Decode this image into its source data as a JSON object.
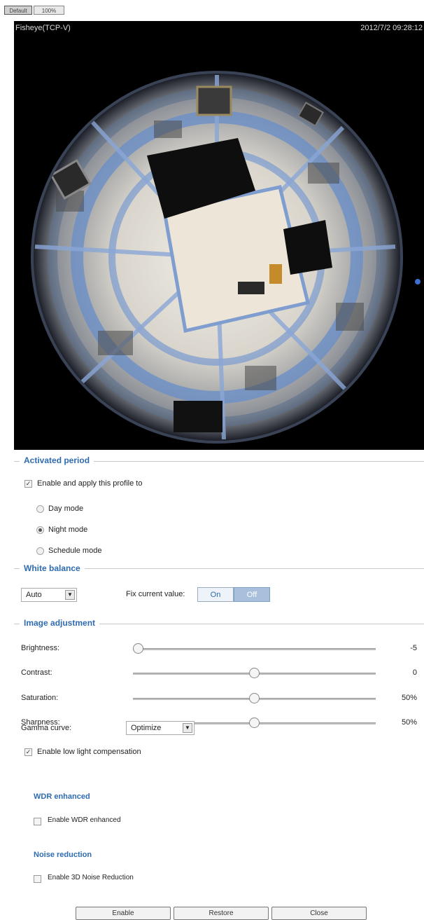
{
  "zoom_tabs": [
    "Default",
    "100%"
  ],
  "video": {
    "title": "Fisheye(TCP-V)",
    "timestamp": "2012/7/2 09:28:12"
  },
  "activated_period": {
    "title": "Activated period",
    "enable_label": "Enable and apply this profile to",
    "enable_checked": true,
    "modes": [
      {
        "label": "Day mode",
        "checked": false
      },
      {
        "label": "Night mode",
        "checked": true
      },
      {
        "label": "Schedule mode",
        "checked": false
      }
    ]
  },
  "white_balance": {
    "title": "White balance",
    "mode_value": "Auto",
    "fix_label": "Fix current value:",
    "on_label": "On",
    "off_label": "Off",
    "selected": "Off"
  },
  "image_adjustment": {
    "title": "Image adjustment",
    "sliders": [
      {
        "label": "Brightness:",
        "value_text": "-5",
        "fraction": 0.0
      },
      {
        "label": "Contrast:",
        "value_text": "0",
        "fraction": 0.5
      },
      {
        "label": "Saturation:",
        "value_text": "50%",
        "fraction": 0.5
      },
      {
        "label": "Sharpness:",
        "value_text": "50%",
        "fraction": 0.5
      }
    ],
    "gamma_label": "Gamma curve:",
    "gamma_value": "Optimize",
    "low_light_label": "Enable low light compensation",
    "low_light_checked": true
  },
  "wdr": {
    "title": "WDR enhanced",
    "enable_label": "Enable WDR enhanced",
    "checked": false
  },
  "noise": {
    "title": "Noise reduction",
    "enable_label": "Enable 3D Noise Reduction",
    "checked": false
  },
  "buttons": {
    "enable": "Enable",
    "restore": "Restore",
    "close": "Close"
  },
  "colors": {
    "accent": "#2f6bb0",
    "video_bg": "#000000"
  }
}
